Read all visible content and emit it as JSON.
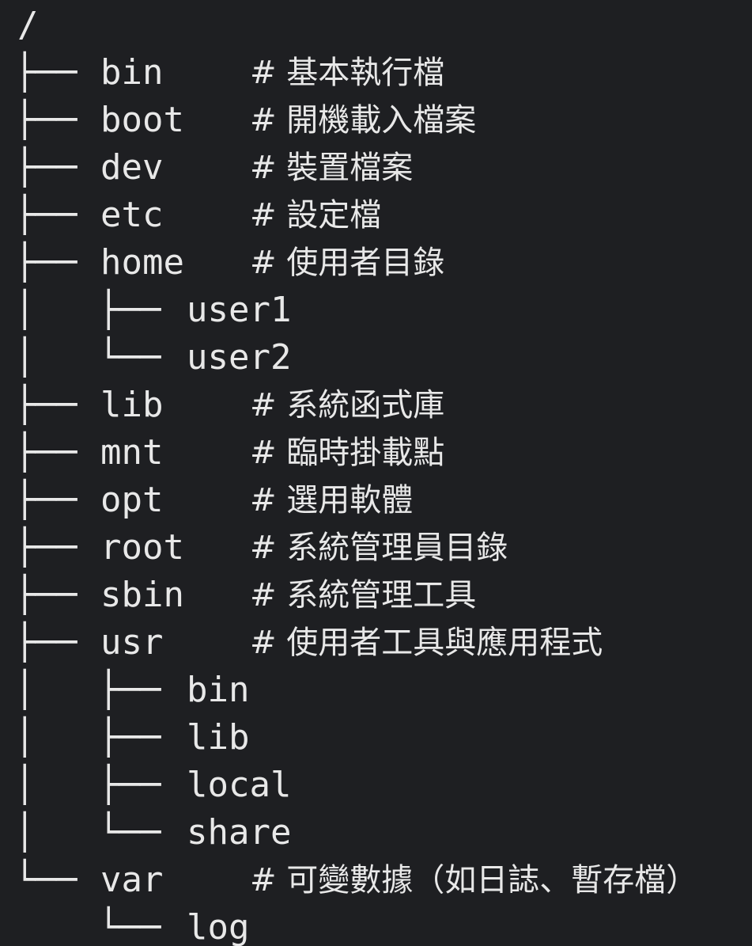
{
  "tree": {
    "root": "/",
    "entries": [
      {
        "prefix": "├── ",
        "name": "bin",
        "comment": "# 基本執行檔"
      },
      {
        "prefix": "├── ",
        "name": "boot",
        "comment": "# 開機載入檔案"
      },
      {
        "prefix": "├── ",
        "name": "dev",
        "comment": "# 裝置檔案"
      },
      {
        "prefix": "├── ",
        "name": "etc",
        "comment": "# 設定檔"
      },
      {
        "prefix": "├── ",
        "name": "home",
        "comment": "# 使用者目錄"
      },
      {
        "prefix": "│   ├── ",
        "name": "user1",
        "comment": ""
      },
      {
        "prefix": "│   └── ",
        "name": "user2",
        "comment": ""
      },
      {
        "prefix": "├── ",
        "name": "lib",
        "comment": "# 系統函式庫"
      },
      {
        "prefix": "├── ",
        "name": "mnt",
        "comment": "# 臨時掛載點"
      },
      {
        "prefix": "├── ",
        "name": "opt",
        "comment": "# 選用軟體"
      },
      {
        "prefix": "├── ",
        "name": "root",
        "comment": "# 系統管理員目錄"
      },
      {
        "prefix": "├── ",
        "name": "sbin",
        "comment": "# 系統管理工具"
      },
      {
        "prefix": "├── ",
        "name": "usr",
        "comment": "# 使用者工具與應用程式"
      },
      {
        "prefix": "│   ├── ",
        "name": "bin",
        "comment": ""
      },
      {
        "prefix": "│   ├── ",
        "name": "lib",
        "comment": ""
      },
      {
        "prefix": "│   ├── ",
        "name": "local",
        "comment": ""
      },
      {
        "prefix": "│   └── ",
        "name": "share",
        "comment": ""
      },
      {
        "prefix": "└── ",
        "name": "var",
        "comment": "# 可變數據（如日誌、暫存檔）"
      },
      {
        "prefix": "    └── ",
        "name": "log",
        "comment": ""
      }
    ]
  }
}
